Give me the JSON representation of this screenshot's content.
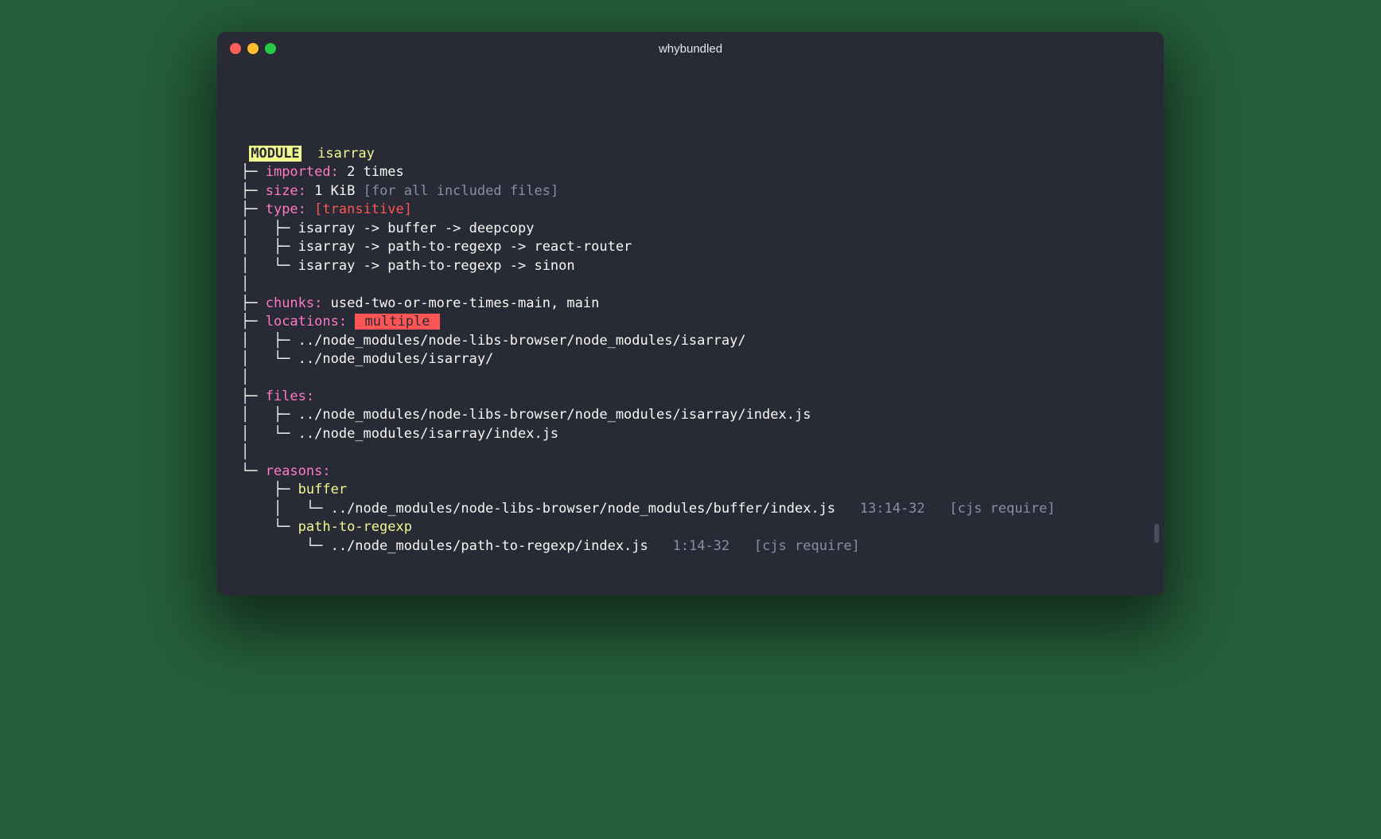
{
  "window": {
    "title": "whybundled"
  },
  "module": {
    "badge": "MODULE",
    "name": "isarray",
    "imported": {
      "label": "imported:",
      "value": "2 times"
    },
    "size": {
      "label": "size:",
      "value": "1 KiB",
      "note": "[for all included files]"
    },
    "type": {
      "label": "type:",
      "value": "[transitive]",
      "chains": [
        "isarray -> buffer -> deepcopy",
        "isarray -> path-to-regexp -> react-router",
        "isarray -> path-to-regexp -> sinon"
      ]
    },
    "chunks": {
      "label": "chunks:",
      "value": "used-two-or-more-times-main, main"
    },
    "locations": {
      "label": "locations:",
      "badge": " multiple ",
      "paths": [
        "../node_modules/node-libs-browser/node_modules/isarray/",
        "../node_modules/isarray/"
      ]
    },
    "files": {
      "label": "files:",
      "paths": [
        "../node_modules/node-libs-browser/node_modules/isarray/index.js",
        "../node_modules/isarray/index.js"
      ]
    },
    "reasons": {
      "label": "reasons:",
      "items": [
        {
          "name": "buffer",
          "file": "../node_modules/node-libs-browser/node_modules/buffer/index.js",
          "loc": "13:14-32",
          "kind": "[cjs require]"
        },
        {
          "name": "path-to-regexp",
          "file": "../node_modules/path-to-regexp/index.js",
          "loc": "1:14-32",
          "kind": "[cjs require]"
        }
      ]
    }
  }
}
